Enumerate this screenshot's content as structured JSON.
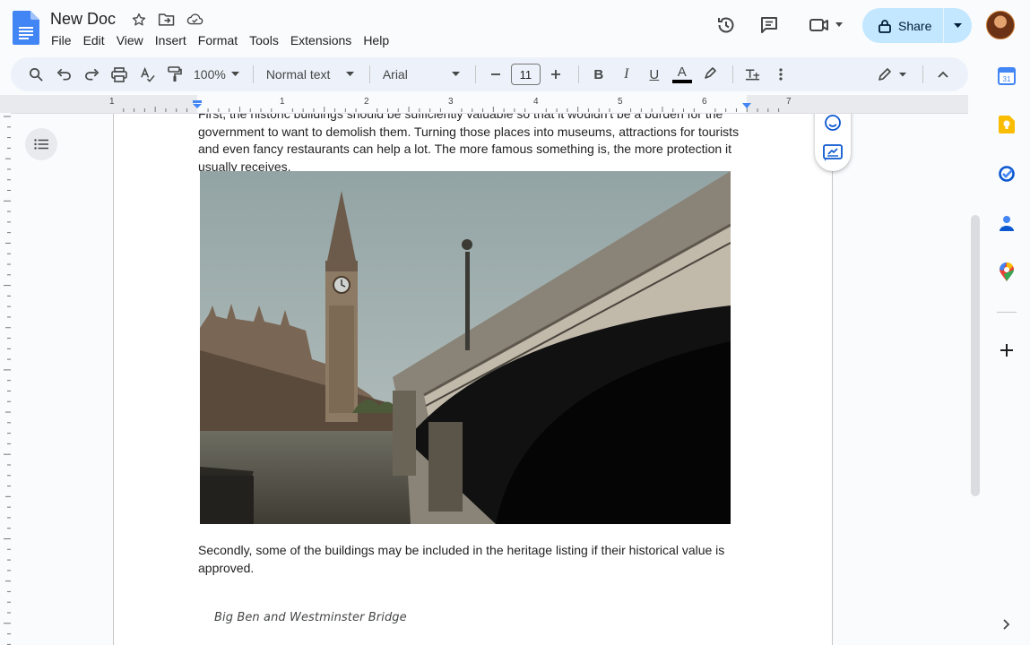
{
  "window": {
    "doc_title": "New Doc",
    "share_label": "Share"
  },
  "menu": [
    "File",
    "Edit",
    "View",
    "Insert",
    "Format",
    "Tools",
    "Extensions",
    "Help"
  ],
  "toolbar": {
    "zoom": "100%",
    "paragraph_style": "Normal text",
    "font": "Arial",
    "font_size": "11",
    "bold": "B",
    "italic": "I",
    "underline": "U",
    "text_color": "A"
  },
  "ruler": {
    "labels": [
      "1",
      "1",
      "2",
      "3",
      "4",
      "5",
      "6",
      "7"
    ]
  },
  "document": {
    "top_paragraph": "First, the historic buildings should be sufficiently valuable so that it wouldn't be a burden for the government to want to demolish them. Turning those places into museums, attractions for tourists and even fancy restaurants can help a lot. The more famous something is, the more protection it usually receives.",
    "second_paragraph": "Secondly, some of the buildings may be included in the heritage listing if their historical value is approved.",
    "caption": "Big Ben and Westminster Bridge",
    "image_subject": "Big Ben and Westminster Bridge photo"
  },
  "colors": {
    "share_bg": "#c2e7ff",
    "toolbar_bg": "#edf2fa",
    "docs_blue": "#4285f4",
    "page_bg": "#ffffff",
    "canvas_bg": "#f9fbfd"
  },
  "icons": {
    "title": [
      "star-icon",
      "move-to-folder-icon",
      "cloud-saved-icon"
    ],
    "top_right": [
      "version-history-icon",
      "comments-icon",
      "meet-icon"
    ],
    "side_panel": [
      "calendar-icon",
      "keep-icon",
      "tasks-icon",
      "contacts-icon",
      "maps-icon",
      "add-icon",
      "expand-panel-icon"
    ]
  }
}
